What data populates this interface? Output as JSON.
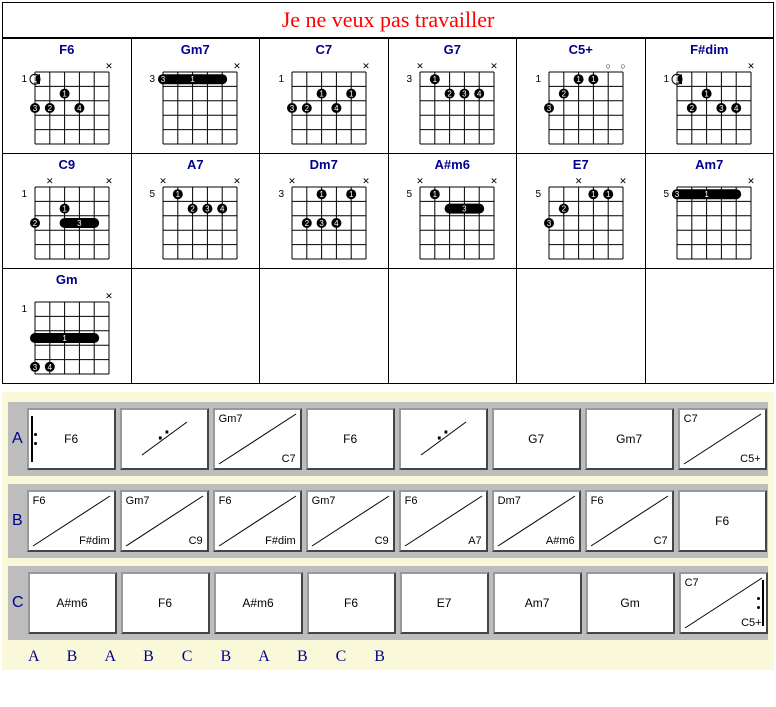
{
  "title": "Je ne veux pas travailler",
  "chords": [
    {
      "name": "F6",
      "fret": 1,
      "barre": null,
      "dots": [
        {
          "s": 1,
          "f": 1,
          "n": "1",
          "half": true
        },
        {
          "s": 3,
          "f": 2,
          "n": "1"
        },
        {
          "s": 1,
          "f": 3,
          "n": "3"
        },
        {
          "s": 2,
          "f": 3,
          "n": "2"
        },
        {
          "s": 4,
          "f": 3,
          "n": "4"
        }
      ],
      "x": [
        6
      ],
      "o": []
    },
    {
      "name": "Gm7",
      "fret": 3,
      "barre": {
        "from": 1,
        "to": 5,
        "f": 1,
        "n": "1"
      },
      "dots": [
        {
          "s": 1,
          "f": 1,
          "n": "3"
        }
      ],
      "x": [
        6
      ],
      "o": []
    },
    {
      "name": "C7",
      "fret": 1,
      "barre": null,
      "dots": [
        {
          "s": 3,
          "f": 2,
          "n": "1"
        },
        {
          "s": 5,
          "f": 2,
          "n": "1"
        },
        {
          "s": 1,
          "f": 3,
          "n": "3"
        },
        {
          "s": 2,
          "f": 3,
          "n": "2"
        },
        {
          "s": 4,
          "f": 3,
          "n": "4"
        }
      ],
      "x": [
        6
      ],
      "o": []
    },
    {
      "name": "G7",
      "fret": 3,
      "barre": null,
      "dots": [
        {
          "s": 2,
          "f": 1,
          "n": "1"
        },
        {
          "s": 3,
          "f": 2,
          "n": "2"
        },
        {
          "s": 4,
          "f": 2,
          "n": "3"
        },
        {
          "s": 5,
          "f": 2,
          "n": "4"
        }
      ],
      "x": [
        1,
        6
      ],
      "o": []
    },
    {
      "name": "C5+",
      "fret": 1,
      "barre": null,
      "dots": [
        {
          "s": 3,
          "f": 1,
          "n": "1"
        },
        {
          "s": 4,
          "f": 1,
          "n": "1"
        },
        {
          "s": 2,
          "f": 2,
          "n": "2"
        },
        {
          "s": 1,
          "f": 3,
          "n": "3"
        }
      ],
      "x": [],
      "o": [
        5,
        6
      ]
    },
    {
      "name": "F#dim",
      "fret": 1,
      "barre": null,
      "dots": [
        {
          "s": 1,
          "f": 1,
          "n": "1",
          "half": true
        },
        {
          "s": 3,
          "f": 2,
          "n": "1"
        },
        {
          "s": 2,
          "f": 3,
          "n": "2"
        },
        {
          "s": 4,
          "f": 3,
          "n": "3"
        },
        {
          "s": 5,
          "f": 3,
          "n": "4"
        }
      ],
      "x": [
        6
      ],
      "o": []
    },
    {
      "name": "C9",
      "fret": 1,
      "barre": {
        "from": 3,
        "to": 5,
        "f": 3,
        "n": "3"
      },
      "dots": [
        {
          "s": 3,
          "f": 2,
          "n": "1"
        },
        {
          "s": 1,
          "f": 3,
          "n": "2"
        }
      ],
      "x": [
        2,
        6
      ],
      "o": []
    },
    {
      "name": "A7",
      "fret": 5,
      "barre": null,
      "dots": [
        {
          "s": 2,
          "f": 1,
          "n": "1"
        },
        {
          "s": 3,
          "f": 2,
          "n": "2"
        },
        {
          "s": 4,
          "f": 2,
          "n": "3"
        },
        {
          "s": 5,
          "f": 2,
          "n": "4"
        }
      ],
      "x": [
        1,
        6
      ],
      "o": []
    },
    {
      "name": "Dm7",
      "fret": 3,
      "barre": null,
      "dots": [
        {
          "s": 3,
          "f": 1,
          "n": "1"
        },
        {
          "s": 5,
          "f": 1,
          "n": "1"
        },
        {
          "s": 2,
          "f": 3,
          "n": "2"
        },
        {
          "s": 3,
          "f": 3,
          "n": "3"
        },
        {
          "s": 4,
          "f": 3,
          "n": "4"
        }
      ],
      "x": [
        1,
        6
      ],
      "o": []
    },
    {
      "name": "A#m6",
      "fret": 5,
      "barre": {
        "from": 3,
        "to": 5,
        "f": 2,
        "n": "3"
      },
      "dots": [
        {
          "s": 2,
          "f": 1,
          "n": "1"
        }
      ],
      "x": [
        1,
        6
      ],
      "o": []
    },
    {
      "name": "E7",
      "fret": 5,
      "barre": null,
      "dots": [
        {
          "s": 4,
          "f": 1,
          "n": "1"
        },
        {
          "s": 5,
          "f": 1,
          "n": "1"
        },
        {
          "s": 2,
          "f": 2,
          "n": "2"
        },
        {
          "s": 1,
          "f": 3,
          "n": "3"
        }
      ],
      "x": [
        3,
        6
      ],
      "o": []
    },
    {
      "name": "Am7",
      "fret": 5,
      "barre": {
        "from": 1,
        "to": 5,
        "f": 1,
        "n": "1"
      },
      "dots": [
        {
          "s": 1,
          "f": 1,
          "n": "3"
        }
      ],
      "x": [
        6
      ],
      "o": []
    },
    {
      "name": "Gm",
      "fret": 1,
      "barre": {
        "from": 1,
        "to": 5,
        "f": 3,
        "n": "1"
      },
      "dots": [
        {
          "s": 1,
          "f": 5,
          "n": "3"
        },
        {
          "s": 2,
          "f": 5,
          "n": "4"
        }
      ],
      "x": [
        6
      ],
      "o": []
    }
  ],
  "progressions": {
    "A": [
      {
        "c": "F6",
        "repeatL": true
      },
      {
        "sim": true
      },
      {
        "tl": "Gm7",
        "br": "C7",
        "diag": true
      },
      {
        "c": "F6"
      },
      {
        "sim": true
      },
      {
        "c": "G7"
      },
      {
        "c": "Gm7"
      },
      {
        "tl": "C7",
        "br": "C5+",
        "diag": true
      }
    ],
    "B": [
      {
        "tl": "F6",
        "br": "F#dim",
        "diag": true
      },
      {
        "tl": "Gm7",
        "br": "C9",
        "diag": true
      },
      {
        "tl": "F6",
        "br": "F#dim",
        "diag": true
      },
      {
        "tl": "Gm7",
        "br": "C9",
        "diag": true
      },
      {
        "tl": "F6",
        "br": "A7",
        "diag": true
      },
      {
        "tl": "Dm7",
        "br": "A#m6",
        "diag": true
      },
      {
        "tl": "F6",
        "br": "C7",
        "diag": true
      },
      {
        "c": "F6"
      }
    ],
    "C": [
      {
        "c": "A#m6"
      },
      {
        "c": "F6"
      },
      {
        "c": "A#m6"
      },
      {
        "c": "F6"
      },
      {
        "c": "E7"
      },
      {
        "c": "Am7"
      },
      {
        "c": "Gm"
      },
      {
        "tl": "C7",
        "br": "C5+",
        "diag": true,
        "repeatR": true
      }
    ]
  },
  "prog_labels": {
    "A": "A",
    "B": "B",
    "C": "C"
  },
  "structure": "ABABCBABCB"
}
